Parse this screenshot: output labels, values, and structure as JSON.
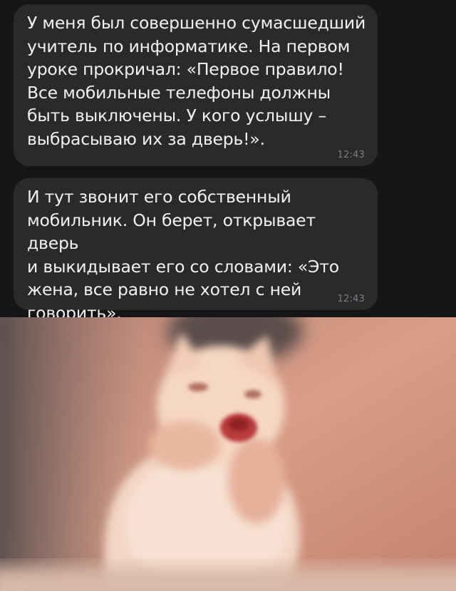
{
  "messages": [
    {
      "text": "У меня был совершенно сумасшедший\nучитель по информатике. На первом\nуроке прокричал: «Первое правило!\nВсе мобильные телефоны должны\nбыть выключены. У кого услышу –\nвыбрасываю их за дверь!».",
      "time": "12:43"
    },
    {
      "text": "И тут звонит его собственный\nмобильник. Он берет, открывает дверь\nи выкидывает его со словами: «Это\nжена, все равно не хотел с ней\nговорить».",
      "time": "12:43"
    }
  ],
  "colors": {
    "chat_background": "#161618",
    "bubble": "#2a2a2d",
    "text": "#f2f2f2",
    "time": "#7c7c80"
  },
  "image": {
    "icon": "laughing-cat-photo"
  }
}
